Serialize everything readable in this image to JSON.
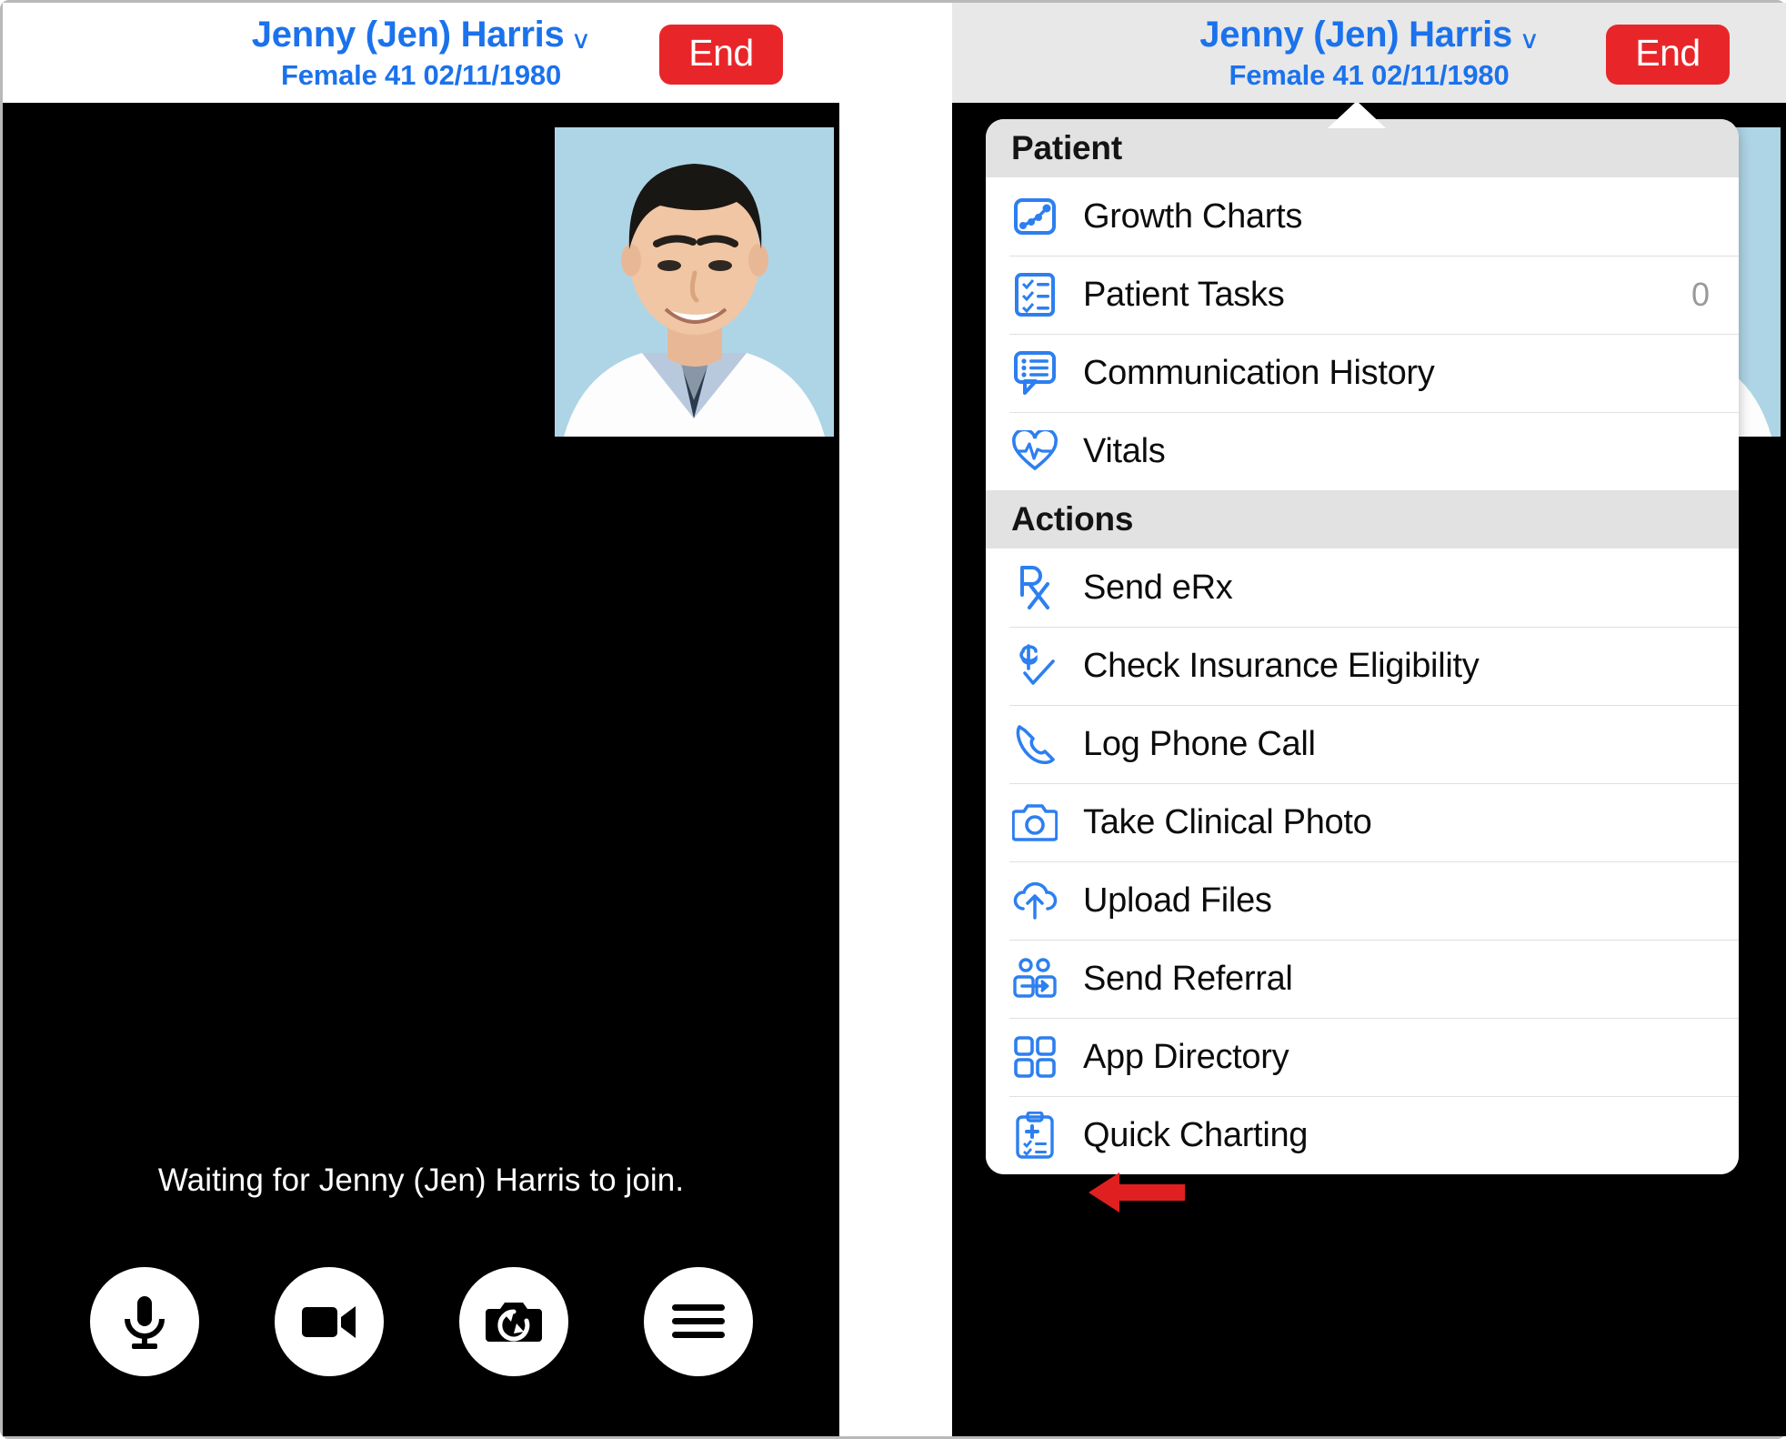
{
  "header": {
    "patient_name": "Jenny (Jen) Harris",
    "chevron": "∨",
    "patient_meta": "Female 41 02/11/1980",
    "end_label": "End"
  },
  "video_call": {
    "waiting_text": "Waiting for Jenny (Jen) Harris to join.",
    "controls": [
      {
        "name": "microphone",
        "icon": "microphone-icon"
      },
      {
        "name": "camera",
        "icon": "video-camera-icon"
      },
      {
        "name": "flip-camera",
        "icon": "camera-flip-icon"
      },
      {
        "name": "more-menu",
        "icon": "hamburger-menu-icon"
      }
    ]
  },
  "popover": {
    "sections": [
      {
        "title": "Patient",
        "items": [
          {
            "label": "Growth Charts",
            "icon": "growth-chart-icon",
            "badge": ""
          },
          {
            "label": "Patient Tasks",
            "icon": "checklist-icon",
            "badge": "0"
          },
          {
            "label": "Communication History",
            "icon": "comment-list-icon",
            "badge": ""
          },
          {
            "label": "Vitals",
            "icon": "heart-pulse-icon",
            "badge": ""
          }
        ]
      },
      {
        "title": "Actions",
        "items": [
          {
            "label": "Send eRx",
            "icon": "rx-icon",
            "badge": ""
          },
          {
            "label": "Check Insurance Eligibility",
            "icon": "dollar-check-icon",
            "badge": ""
          },
          {
            "label": "Log Phone Call",
            "icon": "phone-icon",
            "badge": ""
          },
          {
            "label": "Take Clinical Photo",
            "icon": "camera-icon",
            "badge": ""
          },
          {
            "label": "Upload Files",
            "icon": "cloud-upload-icon",
            "badge": ""
          },
          {
            "label": "Send Referral",
            "icon": "people-arrow-icon",
            "badge": ""
          },
          {
            "label": "App Directory",
            "icon": "grid-squares-icon",
            "badge": ""
          },
          {
            "label": "Quick Charting",
            "icon": "clipboard-plus-icon",
            "badge": ""
          }
        ]
      }
    ],
    "annotation": {
      "type": "red-arrow-left",
      "points_at": "Quick Charting",
      "color": "#e02020"
    }
  },
  "colors": {
    "accent_blue": "#1b72ec",
    "icon_blue": "#2d7ff0",
    "end_red": "#e8262a",
    "annotation_red": "#e02020",
    "section_header_bg": "#e2e2e2"
  }
}
